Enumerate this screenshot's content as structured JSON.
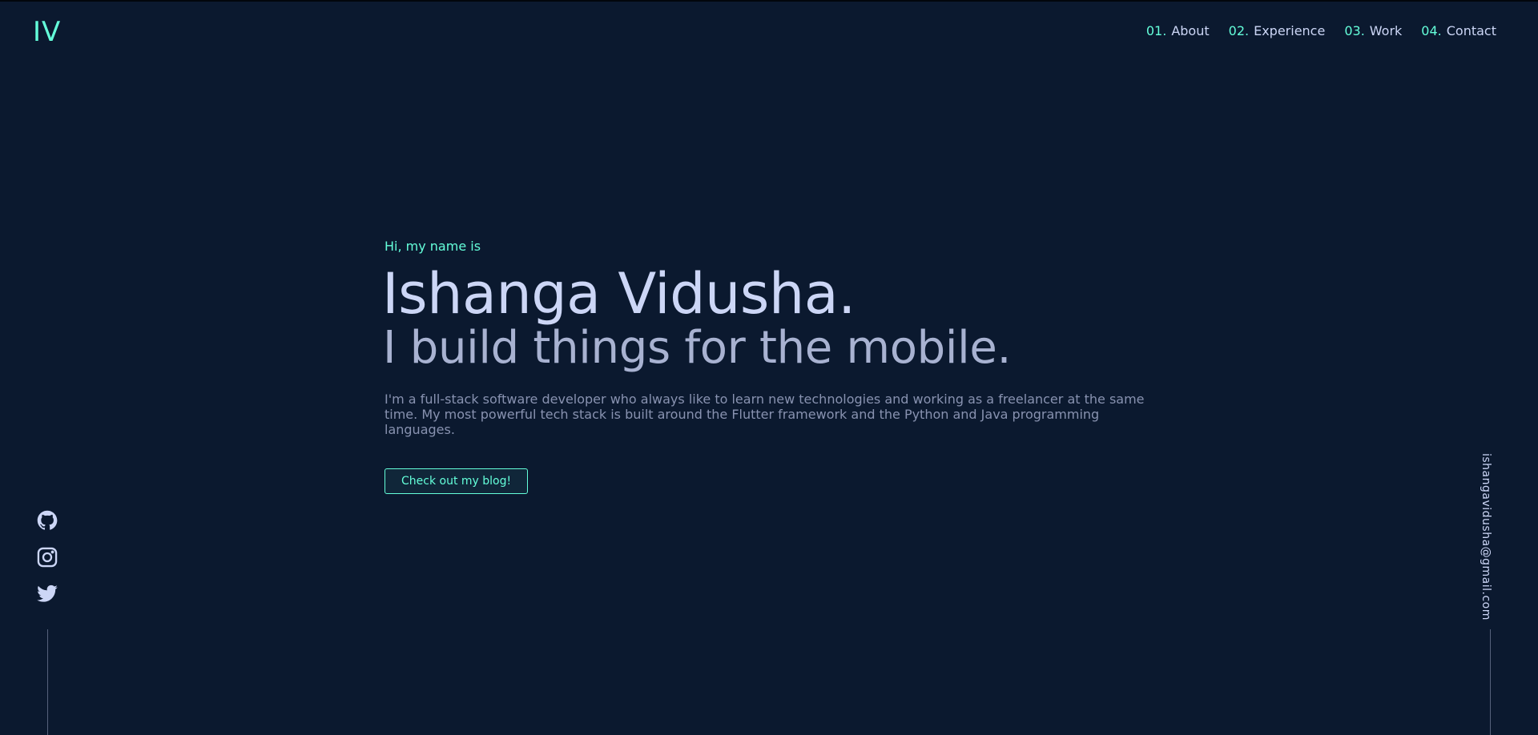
{
  "header": {
    "logo": "IV",
    "nav": [
      {
        "num": "01.",
        "label": "About"
      },
      {
        "num": "02.",
        "label": "Experience"
      },
      {
        "num": "03.",
        "label": "Work"
      },
      {
        "num": "04.",
        "label": "Contact"
      }
    ]
  },
  "hero": {
    "greeting": "Hi, my name is",
    "name": "Ishanga Vidusha.",
    "tagline": "I build things for the mobile.",
    "intro": "I'm a full-stack software developer who always like to learn new technologies and working as a freelancer at the same time. My most powerful tech stack is built around the Flutter framework and the Python and Java programming languages.",
    "cta_label": "Check out my blog!"
  },
  "socials": [
    {
      "icon": "github-icon"
    },
    {
      "icon": "instagram-icon"
    },
    {
      "icon": "twitter-icon"
    }
  ],
  "email": "ishangavidusha@gmail.com",
  "colors": {
    "background": "#0b192f",
    "accent": "#64ffda",
    "heading": "#ccd6f6",
    "subheading": "#a8b2d1",
    "body": "#8892b0"
  }
}
